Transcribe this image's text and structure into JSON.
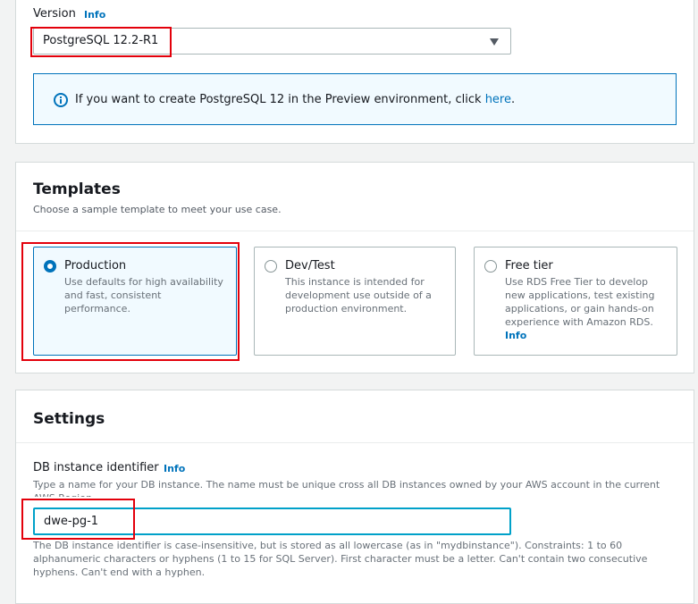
{
  "version": {
    "label": "Version",
    "info": "Info",
    "selected": "PostgreSQL 12.2-R1",
    "alert_text": "If you want to create PostgreSQL 12 in the Preview environment, click ",
    "alert_link": "here",
    "alert_end": "."
  },
  "templates": {
    "title": "Templates",
    "description": "Choose a sample template to meet your use case.",
    "options": [
      {
        "title": "Production",
        "description": "Use defaults for high availability and fast, consistent performance.",
        "selected": true
      },
      {
        "title": "Dev/Test",
        "description": "This instance is intended for development use outside of a production environment.",
        "selected": false
      },
      {
        "title": "Free tier",
        "description": "Use RDS Free Tier to develop new applications, test existing applications, or gain hands-on experience with Amazon RDS.",
        "info": "Info",
        "selected": false
      }
    ]
  },
  "settings": {
    "title": "Settings",
    "identifier_label": "DB instance identifier",
    "info": "Info",
    "identifier_hint": "Type a name for your DB instance. The name must be unique cross all DB instances owned by your AWS account in the current AWS Region.",
    "identifier_value": "dwe-pg-1",
    "identifier_constraints": "The DB instance identifier is case-insensitive, but is stored as all lowercase (as in \"mydbinstance\"). Constraints: 1 to 60 alphanumeric characters or hyphens (1 to 15 for SQL Server). First character must be a letter. Can't contain two consecutive hyphens. Can't end with a hyphen."
  },
  "colors": {
    "link": "#0073bb",
    "highlight": "#e3000b",
    "input_focus": "#00a1c9"
  }
}
